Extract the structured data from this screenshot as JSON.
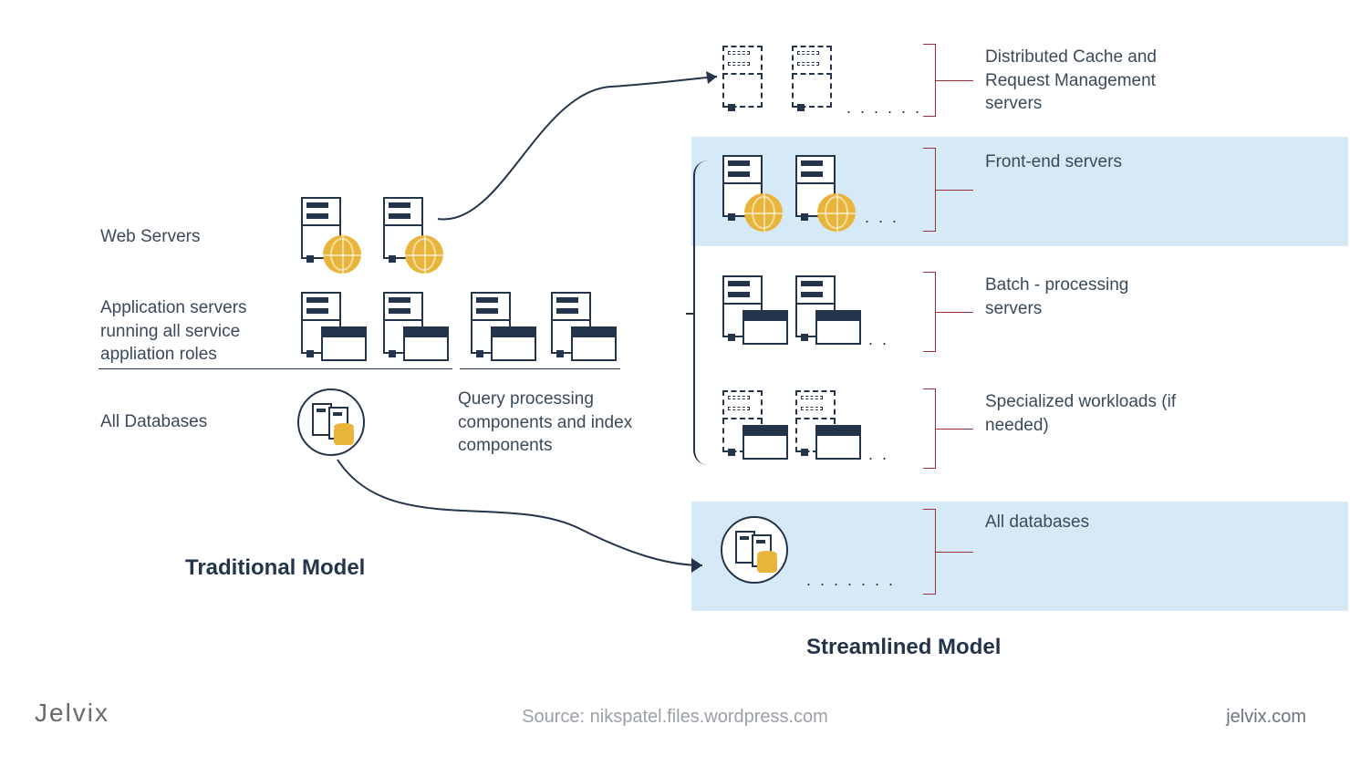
{
  "left": {
    "web_servers": "Web Servers",
    "app_servers": "Application servers running all service appliation roles",
    "databases": "All Databases",
    "query_components": "Query processing components and index components",
    "title": "Traditional Model"
  },
  "right": {
    "cache": "Distributed Cache and Request Management servers",
    "frontend": "Front-end servers",
    "batch": "Batch - processing servers",
    "specialized": "Specialized workloads (if needed)",
    "databases": "All databases",
    "title": "Streamlined Model"
  },
  "footer": {
    "logo": "Jelvix",
    "source": "Source: nikspatel.files.wordpress.com",
    "url": "jelvix.com"
  },
  "colors": {
    "accent": "#e9b43a",
    "ink": "#23344b",
    "bracket": "#9d2e3a",
    "highlight": "#d6e9f7"
  }
}
